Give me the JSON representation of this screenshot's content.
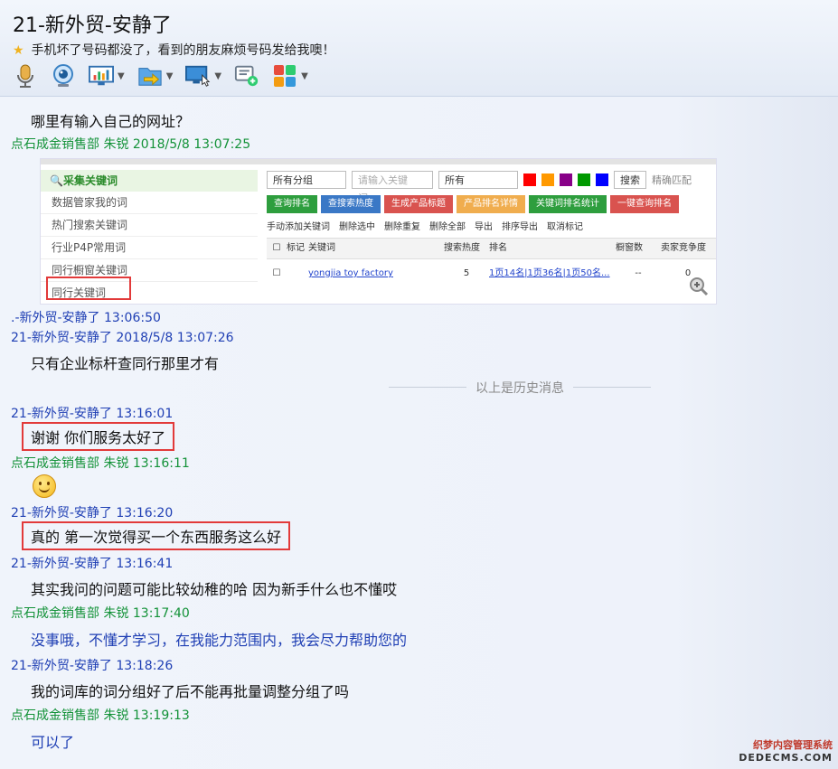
{
  "header": {
    "title": "21-新外贸-安静了",
    "signature": "手机坏了号码都没了，看到的朋友麻烦号码发给我噢！"
  },
  "toolbar": {
    "items": [
      {
        "icon": "microphone-icon",
        "has_menu": false
      },
      {
        "icon": "webcam-icon",
        "has_menu": false
      },
      {
        "icon": "screen-share-icon",
        "has_menu": true
      },
      {
        "icon": "file-transfer-icon",
        "has_menu": true
      },
      {
        "icon": "remote-desktop-icon",
        "has_menu": true
      },
      {
        "icon": "add-message-icon",
        "has_menu": false
      },
      {
        "icon": "apps-grid-icon",
        "has_menu": true
      }
    ]
  },
  "messages": {
    "m1_text": "哪里有输入自己的网址？",
    "m2_head": "点石成金销售部 朱锐 2018/5/8 13:07:25",
    "m3_head": ".-新外贸-安静了  13:06:50",
    "m4_head": "21-新外贸-安静了 2018/5/8 13:07:26",
    "m4_text": "只有企业标杆查同行那里才有",
    "history_divider": "以上是历史消息",
    "m5_head": "21-新外贸-安静了  13:16:01",
    "m5_text": "谢谢 你们服务太好了",
    "m6_head": "点石成金销售部 朱锐  13:16:11",
    "m7_head": "21-新外贸-安静了  13:16:20",
    "m7_text": "真的 第一次觉得买一个东西服务这么好",
    "m8_head": "21-新外贸-安静了  13:16:41",
    "m8_text": "其实我问的问题可能比较幼稚的哈 因为新手什么也不懂哎",
    "m9_head": "点石成金销售部 朱锐  13:17:40",
    "m9_text": "没事哦，不懂才学习，在我能力范围内，我会尽力帮助您的",
    "m10_head": "21-新外贸-安静了  13:18:26",
    "m10_text": "我的词库的词分组好了后不能再批量调整分组了吗",
    "m11_head": "点石成金销售部 朱锐  13:19:13",
    "m11_text": "可以了"
  },
  "embed": {
    "side_title": "采集关键词",
    "side_items": [
      "数据管家我的词",
      "热门搜索关键词",
      "行业P4P常用词",
      "同行橱窗关键词",
      "同行关键词"
    ],
    "group_select": "所有分组",
    "keyword_placeholder": "请输入关键词...",
    "all_select": "所有",
    "search_btn": "搜索",
    "exact_match": "精确匹配",
    "buttons": [
      "查询排名",
      "查搜索热度",
      "生成产品标题",
      "产品排名详情",
      "关键词排名统计",
      "一键查询排名"
    ],
    "actions": [
      "手动添加关键词",
      "删除选中",
      "删除重复",
      "删除全部",
      "导出",
      "排序导出",
      "取消标记"
    ],
    "columns": [
      "标记",
      "关键词",
      "搜索热度",
      "排名",
      "橱窗数",
      "卖家竞争度"
    ],
    "row": {
      "keyword": "yongjia toy factory",
      "heat": "5",
      "rank": "1页14名|1页36名|1页50名...",
      "window": "--",
      "compete": "0"
    }
  },
  "watermark": {
    "line1": "织梦内容管理系统",
    "line2": "DEDECMS.COM"
  },
  "colors": {
    "green_sender": "#139238",
    "blue_sender": "#1f3fb4",
    "highlight": "#e23a3a"
  }
}
